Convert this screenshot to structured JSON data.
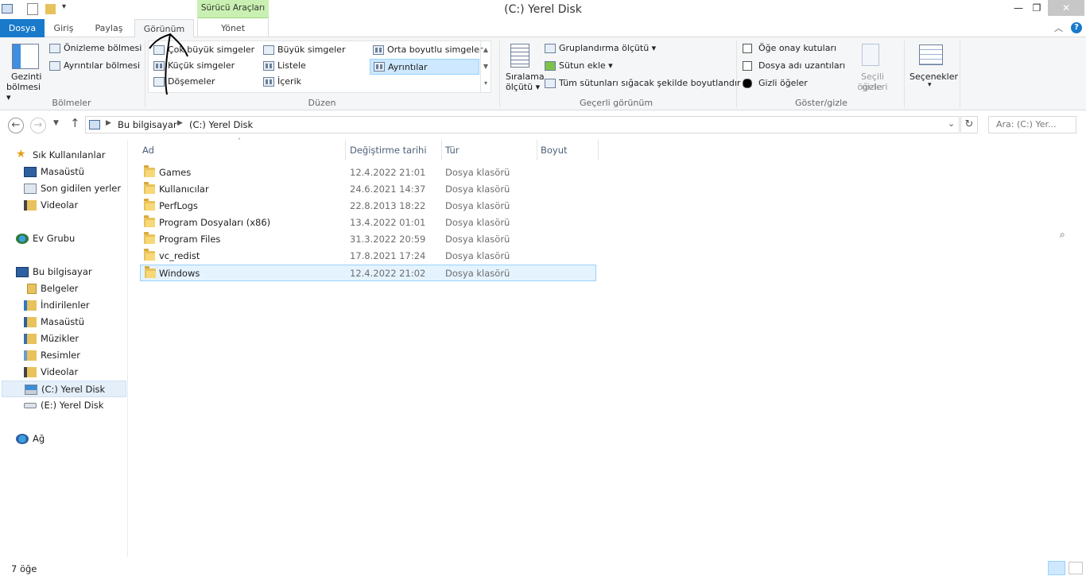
{
  "title": {
    "context_header": "Sürücü Araçları",
    "window_title": "(C:) Yerel Disk",
    "minimize": "—",
    "restore": "❐",
    "close": "✕"
  },
  "tabs": [
    "Dosya",
    "Giriş",
    "Paylaş",
    "Görünüm",
    "Yönet"
  ],
  "ribbon": {
    "panes": {
      "nav_pane_line1": "Gezinti",
      "nav_pane_line2": "bölmesi ▾",
      "preview": "Önizleme bölmesi",
      "details_pane": "Ayrıntılar bölmesi",
      "label": "Bölmeler"
    },
    "layout": {
      "extra_large": "Çok büyük simgeler",
      "large": "Büyük simgeler",
      "medium": "Orta boyutlu simgeler",
      "small": "Küçük simgeler",
      "list": "Listele",
      "details": "Ayrıntılar",
      "tiles": "Döşemeler",
      "content": "İçerik",
      "label": "Düzen"
    },
    "current_view": {
      "sort_line1": "Sıralama",
      "sort_line2": "ölçütü ▾",
      "group_by": "Gruplandırma ölçütü ▾",
      "add_columns": "Sütun ekle ▾",
      "size_all": "Tüm sütunları sığacak şekilde boyutlandır",
      "label": "Geçerli görünüm"
    },
    "show_hide": {
      "item_checkboxes": "Öğe onay kutuları",
      "file_extensions": "Dosya adı uzantıları",
      "hidden_items": "Gizli öğeler",
      "hide_selected_line1": "Seçili öğeleri",
      "hide_selected_line2": "gizle",
      "label": "Göster/gizle"
    },
    "options": {
      "label": "Seçenekler",
      "arrow": "▾"
    }
  },
  "address": {
    "crumbs": [
      "Bu bilgisayar",
      "(C:) Yerel Disk"
    ],
    "search_placeholder": "Ara: (C:) Yer..."
  },
  "navpane": {
    "items": [
      {
        "label": "Sık Kullanılanlar",
        "icon": "star-icon"
      },
      {
        "label": "Masaüstü",
        "icon": "desktop-icon"
      },
      {
        "label": "Son gidilen yerler",
        "icon": "recent-places-icon"
      },
      {
        "label": "Videolar",
        "icon": "videos-icon"
      },
      {
        "label": "Ev Grubu",
        "icon": "homegroup-icon"
      },
      {
        "label": "Bu bilgisayar",
        "icon": "computer-icon"
      },
      {
        "label": "Belgeler",
        "icon": "documents-icon"
      },
      {
        "label": "İndirilenler",
        "icon": "downloads-icon"
      },
      {
        "label": "Masaüstü",
        "icon": "desktop-icon"
      },
      {
        "label": "Müzikler",
        "icon": "music-icon"
      },
      {
        "label": "Resimler",
        "icon": "pictures-icon"
      },
      {
        "label": "Videolar",
        "icon": "videos-icon"
      },
      {
        "label": "(C:) Yerel Disk",
        "icon": "drive-c-icon"
      },
      {
        "label": "(E:) Yerel Disk",
        "icon": "drive-e-icon"
      },
      {
        "label": "Ağ",
        "icon": "network-icon"
      }
    ]
  },
  "filelist": {
    "columns": [
      "Ad",
      "Değiştirme tarihi",
      "Tür",
      "Boyut"
    ],
    "rows": [
      {
        "name": "Games",
        "date": "12.4.2022 21:01",
        "type": "Dosya klasörü"
      },
      {
        "name": "Kullanıcılar",
        "date": "24.6.2021 14:37",
        "type": "Dosya klasörü"
      },
      {
        "name": "PerfLogs",
        "date": "22.8.2013 18:22",
        "type": "Dosya klasörü"
      },
      {
        "name": "Program Dosyaları (x86)",
        "date": "13.4.2022 01:01",
        "type": "Dosya klasörü"
      },
      {
        "name": "Program Files",
        "date": "31.3.2022 20:59",
        "type": "Dosya klasörü"
      },
      {
        "name": "vc_redist",
        "date": "17.8.2021 17:24",
        "type": "Dosya klasörü"
      },
      {
        "name": "Windows",
        "date": "12.4.2022 21:02",
        "type": "Dosya klasörü"
      }
    ]
  },
  "status": {
    "count": "7 öğe"
  },
  "colors": {
    "file_tab": "#1979ca",
    "context_tab": "#c9f0b2",
    "selection": "#e5f3ff",
    "folder": "#e8c25c"
  }
}
